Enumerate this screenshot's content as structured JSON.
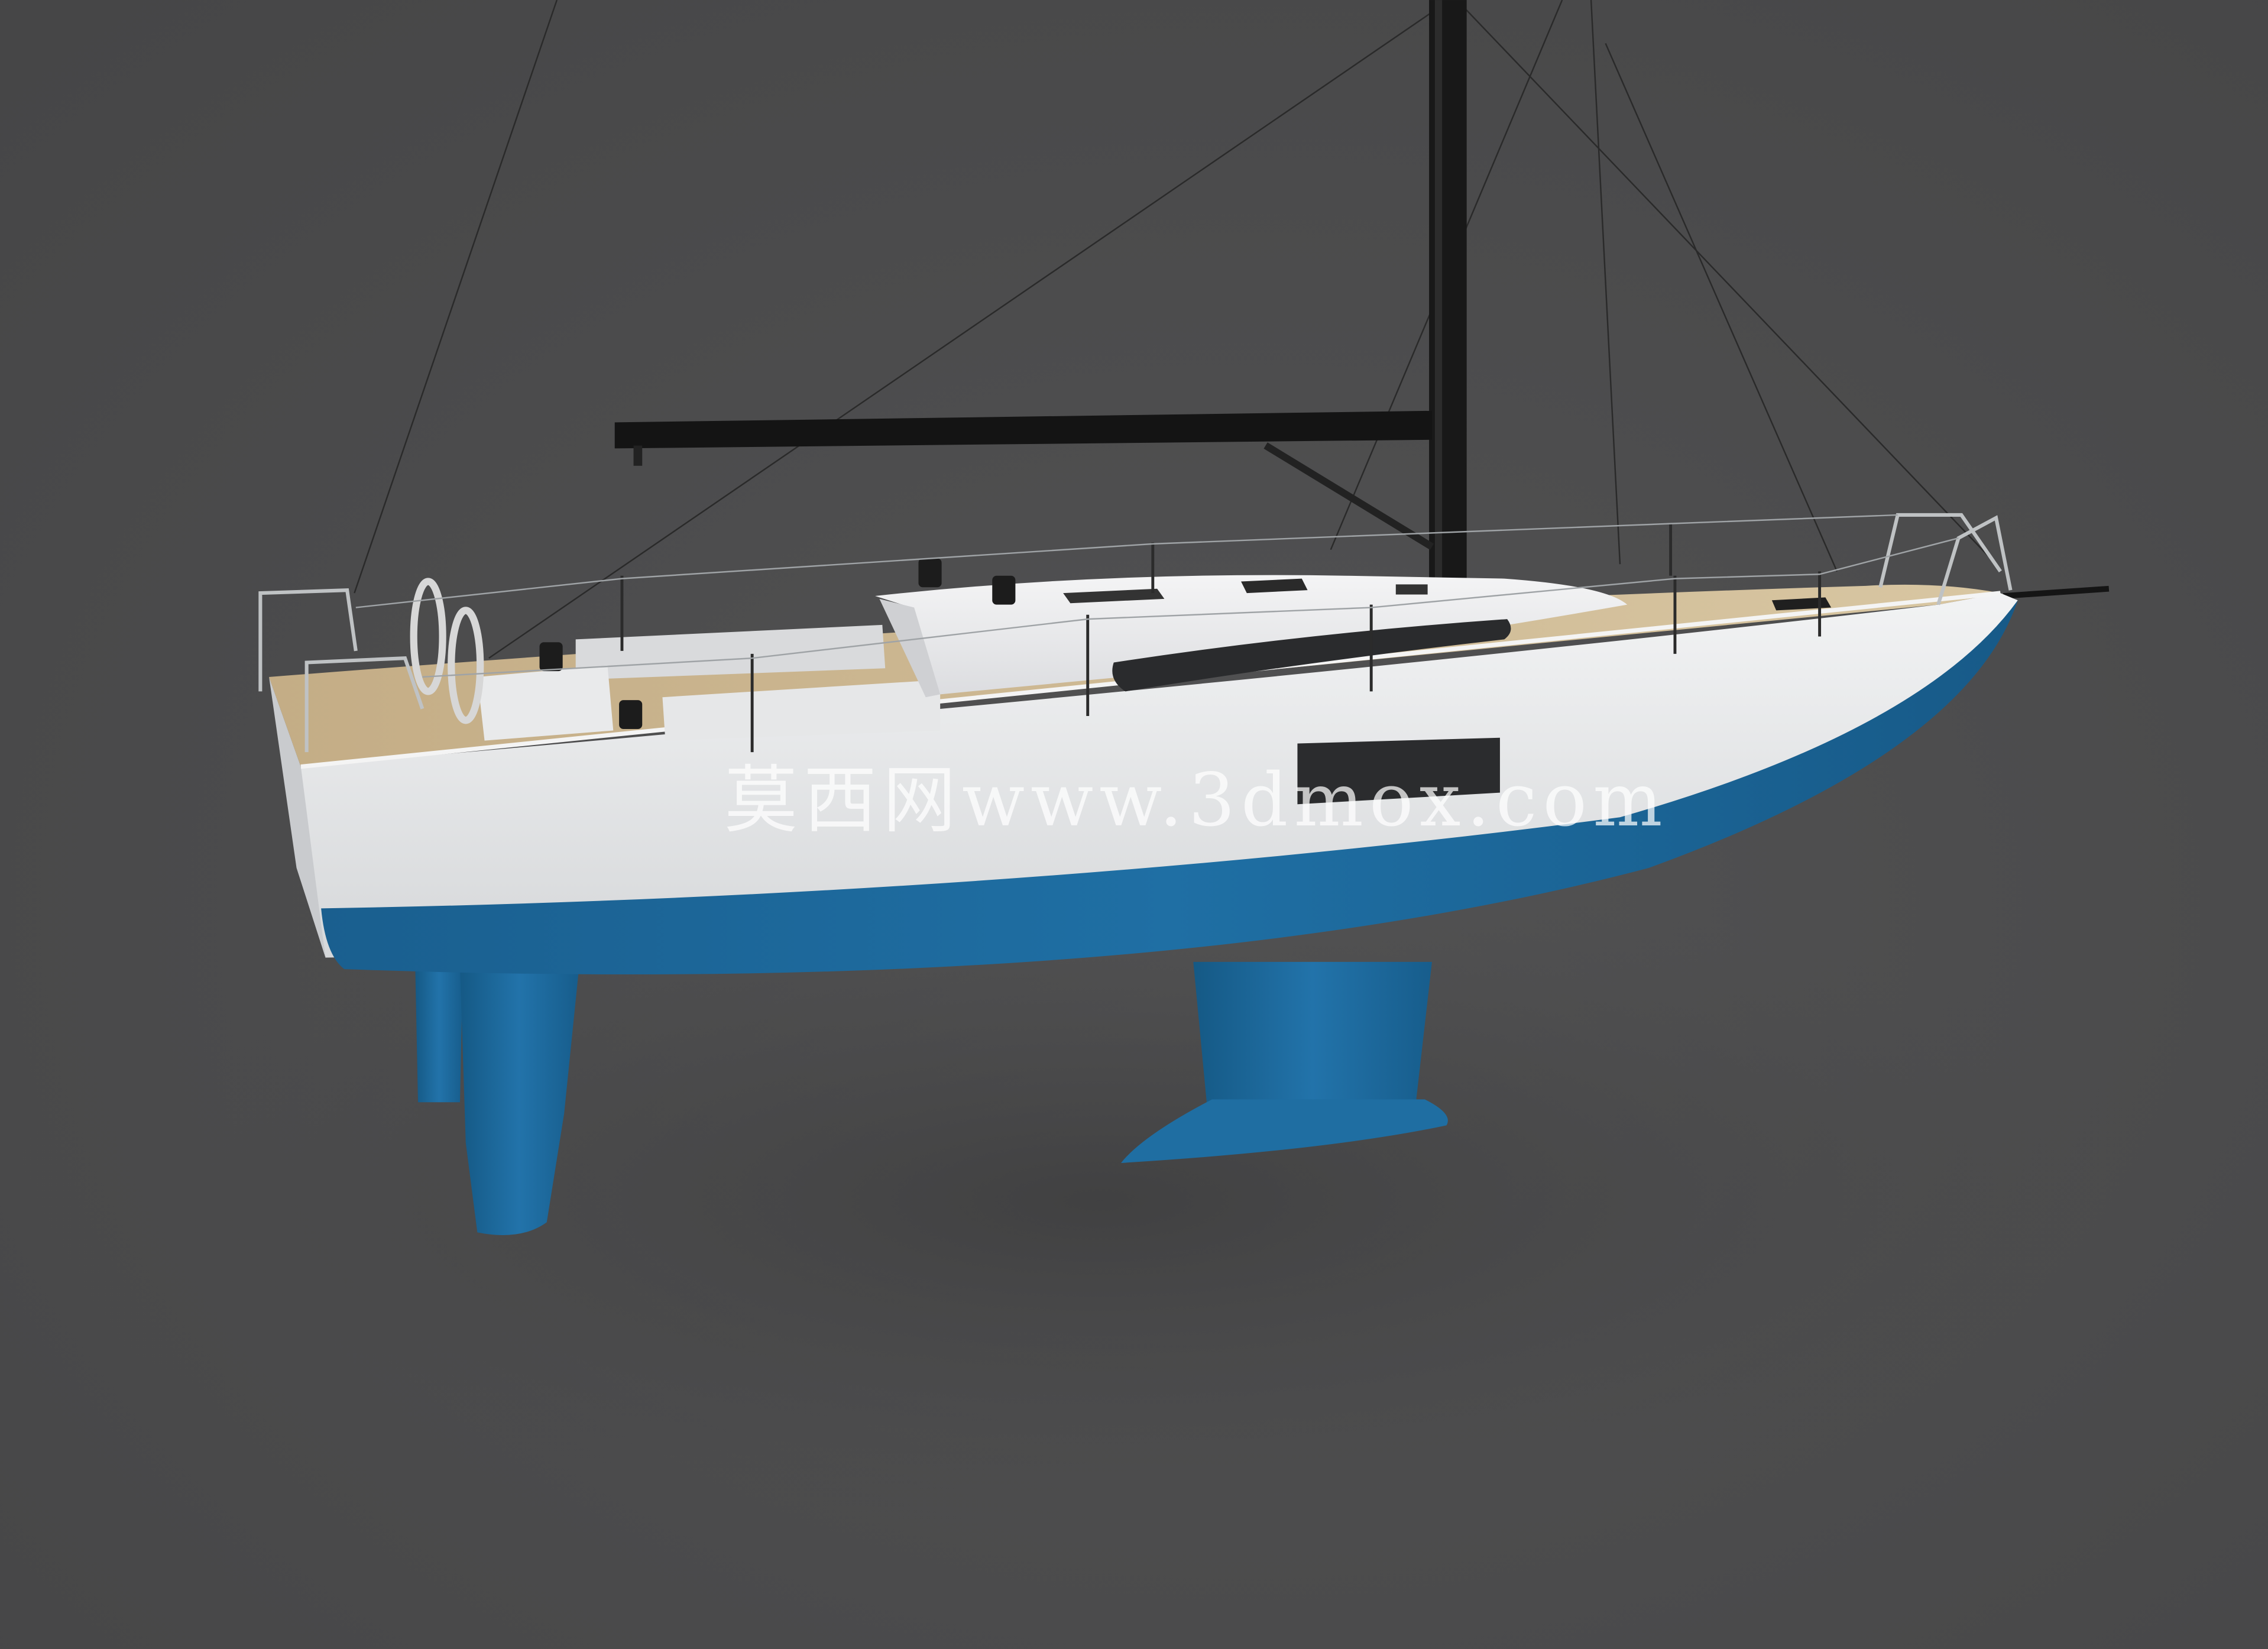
{
  "scene": {
    "subject": "sailboat-3d-render",
    "colors": {
      "background": "#4b4b4c",
      "hull_topside": "#e6e7e8",
      "hull_bottom": "#1d6a9c",
      "deck_teak": "#cdb893",
      "mast": "#1a1a1a",
      "hardware": "#202020"
    }
  },
  "watermark": {
    "text": "莫西网www.3dmox.com"
  }
}
